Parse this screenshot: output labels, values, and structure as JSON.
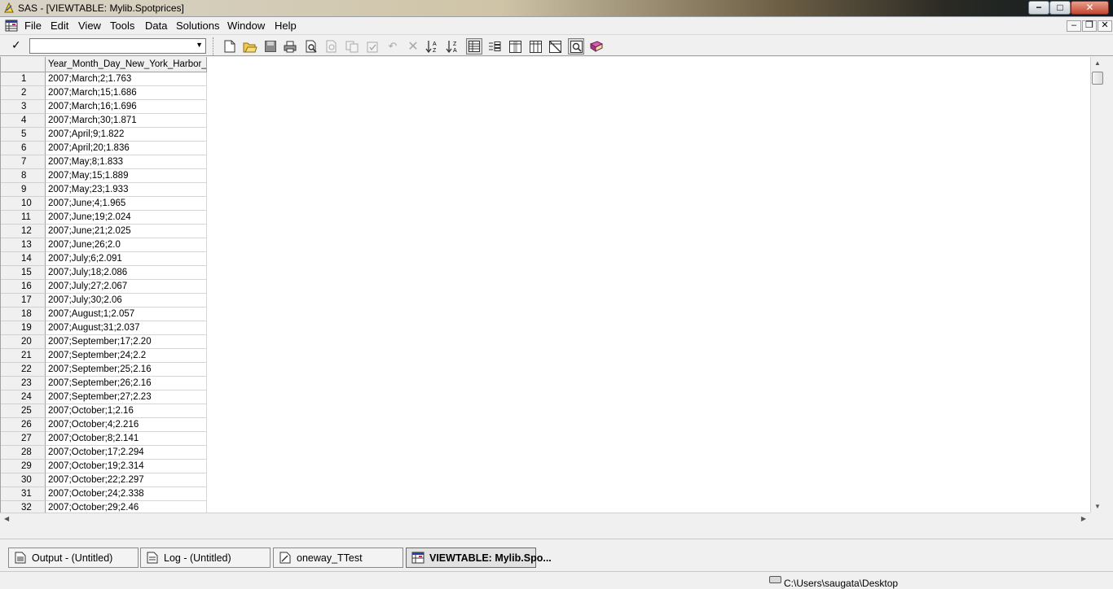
{
  "window": {
    "title": "SAS - [VIEWTABLE: Mylib.Spotprices]",
    "controls": {
      "minimize": "−",
      "maximize": "□",
      "close": "✕"
    },
    "child_controls": {
      "minimize": "–",
      "restore": "❐",
      "close": "✕"
    }
  },
  "menu": [
    "File",
    "Edit",
    "View",
    "Tools",
    "Data",
    "Solutions",
    "Window",
    "Help"
  ],
  "toolbar": {
    "command_value": "",
    "buttons": [
      "new-icon",
      "open-icon",
      "save-icon",
      "print-icon",
      "print-preview-icon",
      "cut-icon",
      "copy-icon",
      "paste-icon",
      "undo-icon",
      "delete-icon",
      "sort-ascending-icon",
      "sort-descending-icon",
      "table-view-icon",
      "form-view-icon",
      "column-icon",
      "hide-column-icon",
      "unhide-column-icon",
      "find-icon",
      "help-icon"
    ]
  },
  "table": {
    "column_header": "Year_Month_Day_New_York_Harbor_N",
    "rows": [
      {
        "n": "1",
        "value": "2007;March;2;1.763"
      },
      {
        "n": "2",
        "value": "2007;March;15;1.686"
      },
      {
        "n": "3",
        "value": "2007;March;16;1.696"
      },
      {
        "n": "4",
        "value": "2007;March;30;1.871"
      },
      {
        "n": "5",
        "value": "2007;April;9;1.822"
      },
      {
        "n": "6",
        "value": "2007;April;20;1.836"
      },
      {
        "n": "7",
        "value": "2007;May;8;1.833"
      },
      {
        "n": "8",
        "value": "2007;May;15;1.889"
      },
      {
        "n": "9",
        "value": "2007;May;23;1.933"
      },
      {
        "n": "10",
        "value": "2007;June;4;1.965"
      },
      {
        "n": "11",
        "value": "2007;June;19;2.024"
      },
      {
        "n": "12",
        "value": "2007;June;21;2.025"
      },
      {
        "n": "13",
        "value": "2007;June;26;2.0"
      },
      {
        "n": "14",
        "value": "2007;July;6;2.091"
      },
      {
        "n": "15",
        "value": "2007;July;18;2.086"
      },
      {
        "n": "16",
        "value": "2007;July;27;2.067"
      },
      {
        "n": "17",
        "value": "2007;July;30;2.06"
      },
      {
        "n": "18",
        "value": "2007;August;1;2.057"
      },
      {
        "n": "19",
        "value": "2007;August;31;2.037"
      },
      {
        "n": "20",
        "value": "2007;September;17;2.20"
      },
      {
        "n": "21",
        "value": "2007;September;24;2.2"
      },
      {
        "n": "22",
        "value": "2007;September;25;2.16"
      },
      {
        "n": "23",
        "value": "2007;September;26;2.16"
      },
      {
        "n": "24",
        "value": "2007;September;27;2.23"
      },
      {
        "n": "25",
        "value": "2007;October;1;2.16"
      },
      {
        "n": "26",
        "value": "2007;October;4;2.216"
      },
      {
        "n": "27",
        "value": "2007;October;8;2.141"
      },
      {
        "n": "28",
        "value": "2007;October;17;2.294"
      },
      {
        "n": "29",
        "value": "2007;October;19;2.314"
      },
      {
        "n": "30",
        "value": "2007;October;22;2.297"
      },
      {
        "n": "31",
        "value": "2007;October;24;2.338"
      },
      {
        "n": "32",
        "value": "2007;October;29;2.46"
      }
    ]
  },
  "window_tabs": [
    {
      "label": "Output - (Untitled)",
      "icon": "output-icon",
      "active": false
    },
    {
      "label": "Log - (Untitled)",
      "icon": "log-icon",
      "active": false
    },
    {
      "label": "oneway_TTest",
      "icon": "program-editor-icon",
      "active": false
    },
    {
      "label": "VIEWTABLE: Mylib.Spo...",
      "icon": "viewtable-icon",
      "active": true
    }
  ],
  "status": {
    "path": "C:\\Users\\saugata\\Desktop"
  }
}
